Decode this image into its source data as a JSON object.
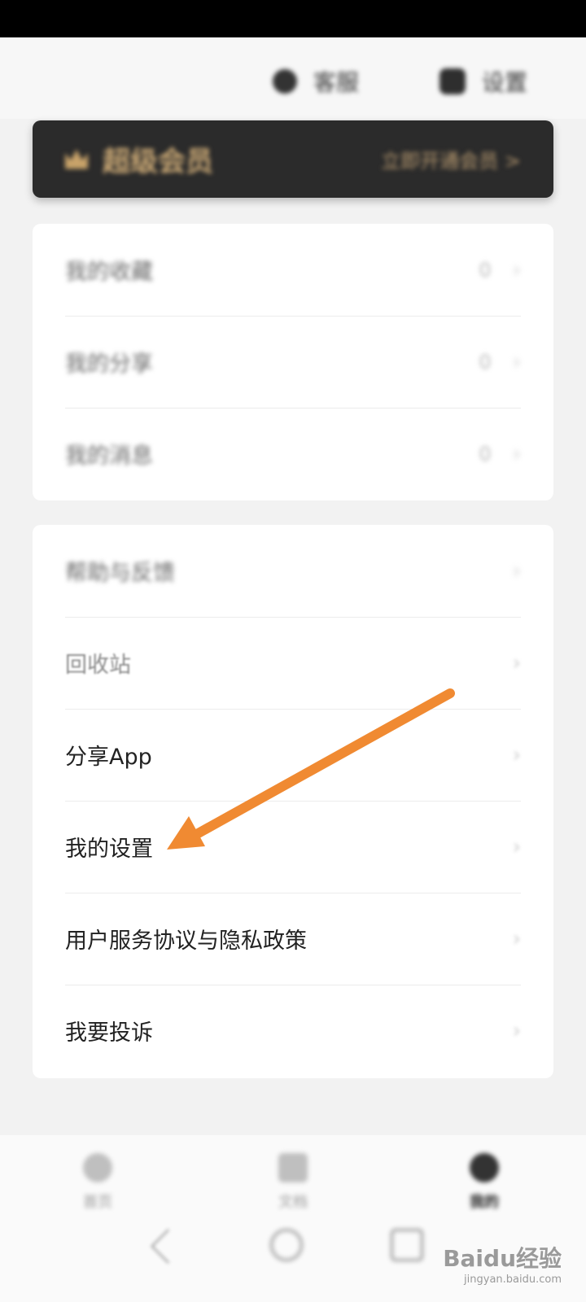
{
  "top_bar": {
    "action1_label": "客服",
    "action2_label": "设置"
  },
  "vip_banner": {
    "title": "超级会员",
    "action": "立即开通会员 >"
  },
  "card1": {
    "items": [
      {
        "label": "我的收藏",
        "count": "0"
      },
      {
        "label": "我的分享",
        "count": "0"
      },
      {
        "label": "我的消息",
        "count": "0"
      }
    ]
  },
  "card2": {
    "items": [
      {
        "label": "帮助与反馈"
      },
      {
        "label": "回收站"
      },
      {
        "label": "分享App"
      },
      {
        "label": "我的设置"
      },
      {
        "label": "用户服务协议与隐私政策"
      },
      {
        "label": "我要投诉"
      }
    ]
  },
  "chevron": "›",
  "annotation": {
    "color": "#f08a32",
    "target": "我的设置"
  },
  "bottom_nav": {
    "tabs": [
      {
        "label": "首页"
      },
      {
        "label": "文档"
      },
      {
        "label": "我的"
      }
    ]
  },
  "watermark": {
    "logo": "Baidu经验",
    "url": "jingyan.baidu.com"
  }
}
